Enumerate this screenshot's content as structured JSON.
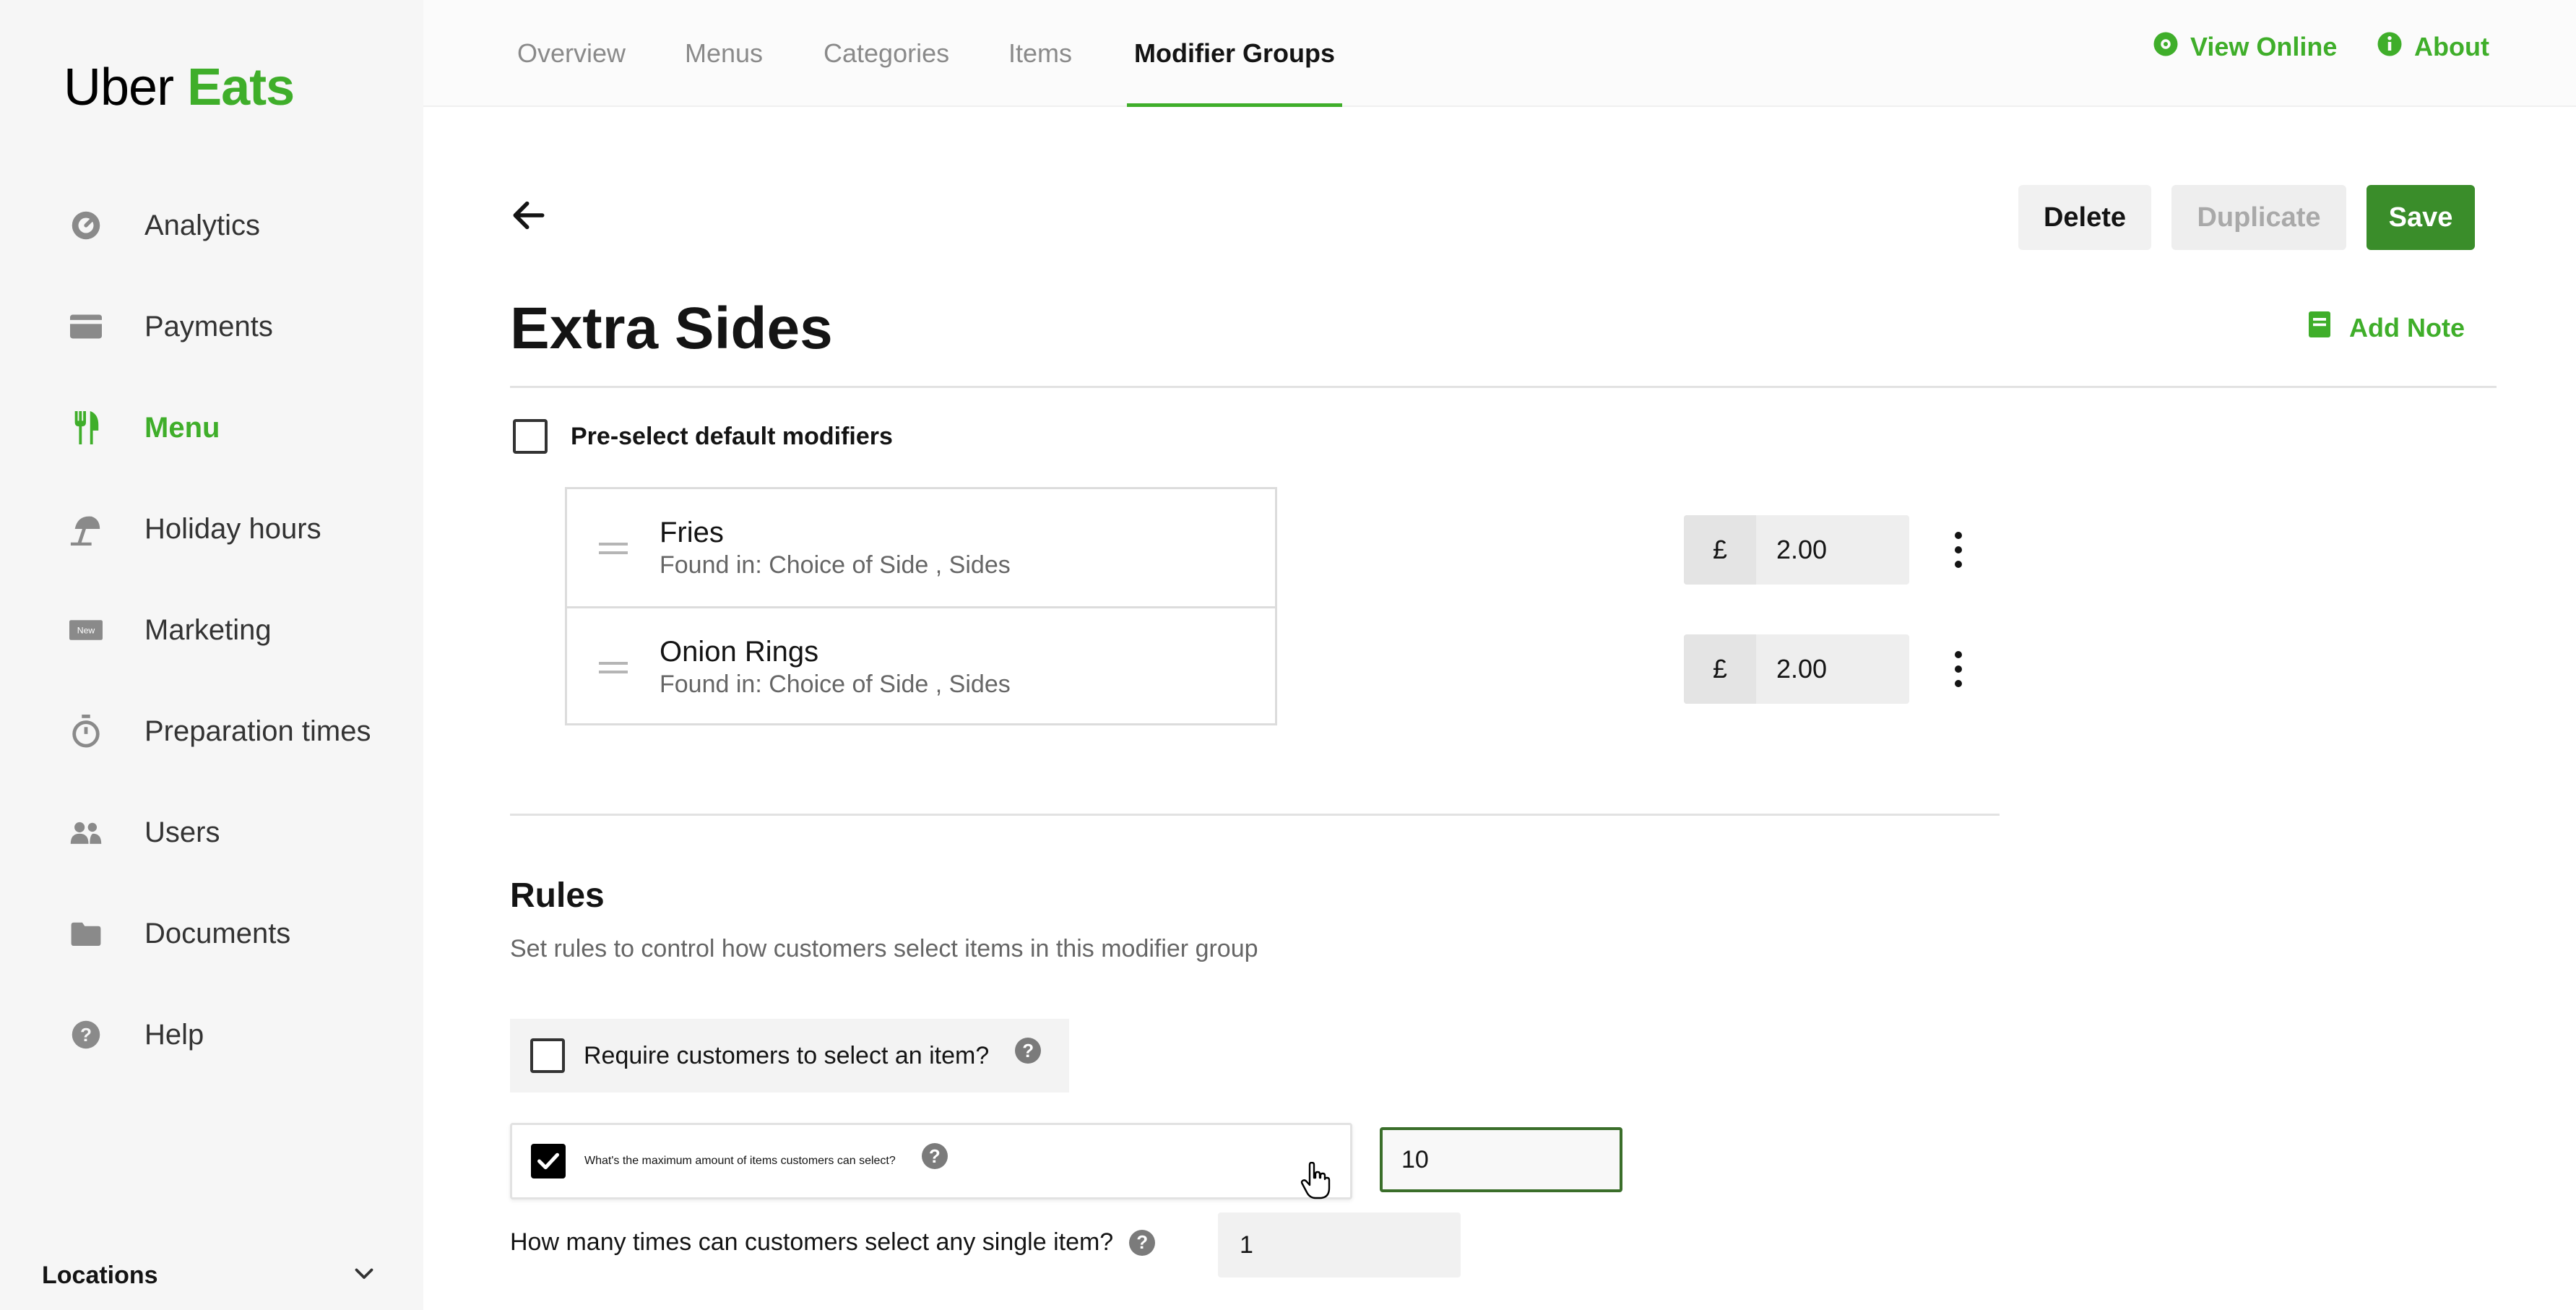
{
  "brand": {
    "logo_uber": "Uber",
    "logo_eats": "Eats",
    "accent": "#3fae2a"
  },
  "sidebar": {
    "items": [
      {
        "label": "Analytics",
        "icon": "analytics-gauge-icon"
      },
      {
        "label": "Payments",
        "icon": "payments-card-icon"
      },
      {
        "label": "Menu",
        "icon": "fork-knife-icon",
        "active": true
      },
      {
        "label": "Holiday hours",
        "icon": "holiday-umbrella-icon"
      },
      {
        "label": "Marketing",
        "icon": "new-badge-icon",
        "badge": "New"
      },
      {
        "label": "Preparation times",
        "icon": "stopwatch-icon"
      },
      {
        "label": "Users",
        "icon": "users-icon"
      },
      {
        "label": "Documents",
        "icon": "folder-icon"
      },
      {
        "label": "Help",
        "icon": "help-circle-icon"
      }
    ],
    "locations_label": "Locations"
  },
  "tabs": [
    {
      "label": "Overview"
    },
    {
      "label": "Menus"
    },
    {
      "label": "Categories"
    },
    {
      "label": "Items"
    },
    {
      "label": "Modifier Groups",
      "active": true
    }
  ],
  "top_links": {
    "view_online": "View Online",
    "about": "About"
  },
  "actions": {
    "delete": "Delete",
    "duplicate": "Duplicate",
    "save": "Save"
  },
  "page": {
    "title": "Extra Sides",
    "add_note": "Add Note"
  },
  "preselect_label": "Pre-select default modifiers",
  "modifiers": [
    {
      "name": "Fries",
      "found_in": "Found in: Choice of Side , Sides",
      "currency": "£",
      "price": "2.00"
    },
    {
      "name": "Onion Rings",
      "found_in": "Found in: Choice of Side , Sides",
      "currency": "£",
      "price": "2.00"
    }
  ],
  "rules": {
    "title": "Rules",
    "subtitle": "Set rules to control how customers select items in this modifier group",
    "require_label": "Require customers to select an item?",
    "require_checked": false,
    "max_label": "What's the maximum amount of items customers can select?",
    "max_checked": true,
    "max_value": "10",
    "single_label": "How many times can customers select any single item?",
    "single_value": "1",
    "help_glyph": "?"
  }
}
